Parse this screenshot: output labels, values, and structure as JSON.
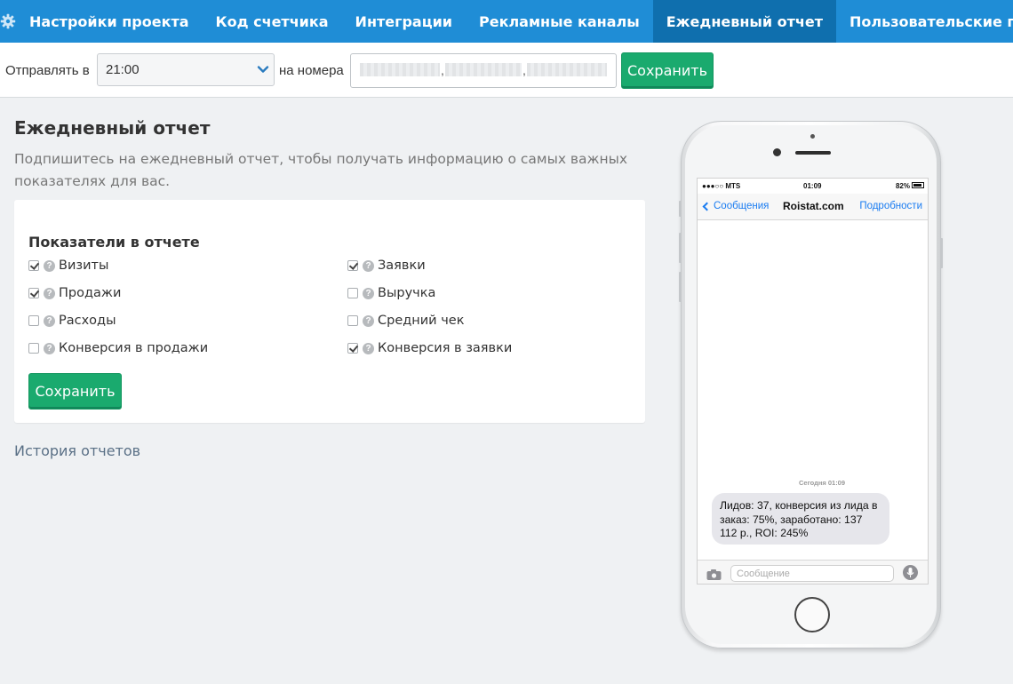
{
  "nav": {
    "tabs": [
      {
        "label": "Настройки проекта"
      },
      {
        "label": "Код счетчика"
      },
      {
        "label": "Интеграции"
      },
      {
        "label": "Рекламные каналы"
      },
      {
        "label": "Ежедневный отчет",
        "active": true
      },
      {
        "label": "Пользовательские права"
      }
    ]
  },
  "send": {
    "send_at_label": "Отправлять в",
    "time_value": "21:00",
    "numbers_label": "на номера",
    "save_label": "Сохранить"
  },
  "page": {
    "title": "Ежедневный отчет",
    "intro": "Подпишитесь на ежедневный отчет, чтобы получать информацию о самых важных показателях для вас."
  },
  "metrics": {
    "title": "Показатели в отчете",
    "items": [
      {
        "label": "Визиты",
        "checked": true
      },
      {
        "label": "Заявки",
        "checked": true
      },
      {
        "label": "Продажи",
        "checked": true
      },
      {
        "label": "Выручка",
        "checked": false
      },
      {
        "label": "Расходы",
        "checked": false
      },
      {
        "label": "Средний чек",
        "checked": false
      },
      {
        "label": "Конверсия в продажи",
        "checked": false
      },
      {
        "label": "Конверсия в заявки",
        "checked": true
      }
    ],
    "save_label": "Сохранить"
  },
  "history_link": "История отчетов",
  "phone": {
    "carrier": "●●●○○ MTS",
    "time": "01:09",
    "battery": "82%",
    "back_label": "Сообщения",
    "contact": "Roistat.com",
    "details_label": "Подробности",
    "timestamp": "Сегодня 01:09",
    "message": "Лидов: 37, конверсия из лида в заказ: 75%, заработано: 137 112 р., ROI: 245%",
    "input_placeholder": "Сообщение"
  },
  "colors": {
    "nav_bg": "#1f8dd6",
    "nav_active": "#0f6fae",
    "save_green": "#1aaa6e",
    "link": "#5a7086",
    "ios_blue": "#1a7cf1"
  }
}
